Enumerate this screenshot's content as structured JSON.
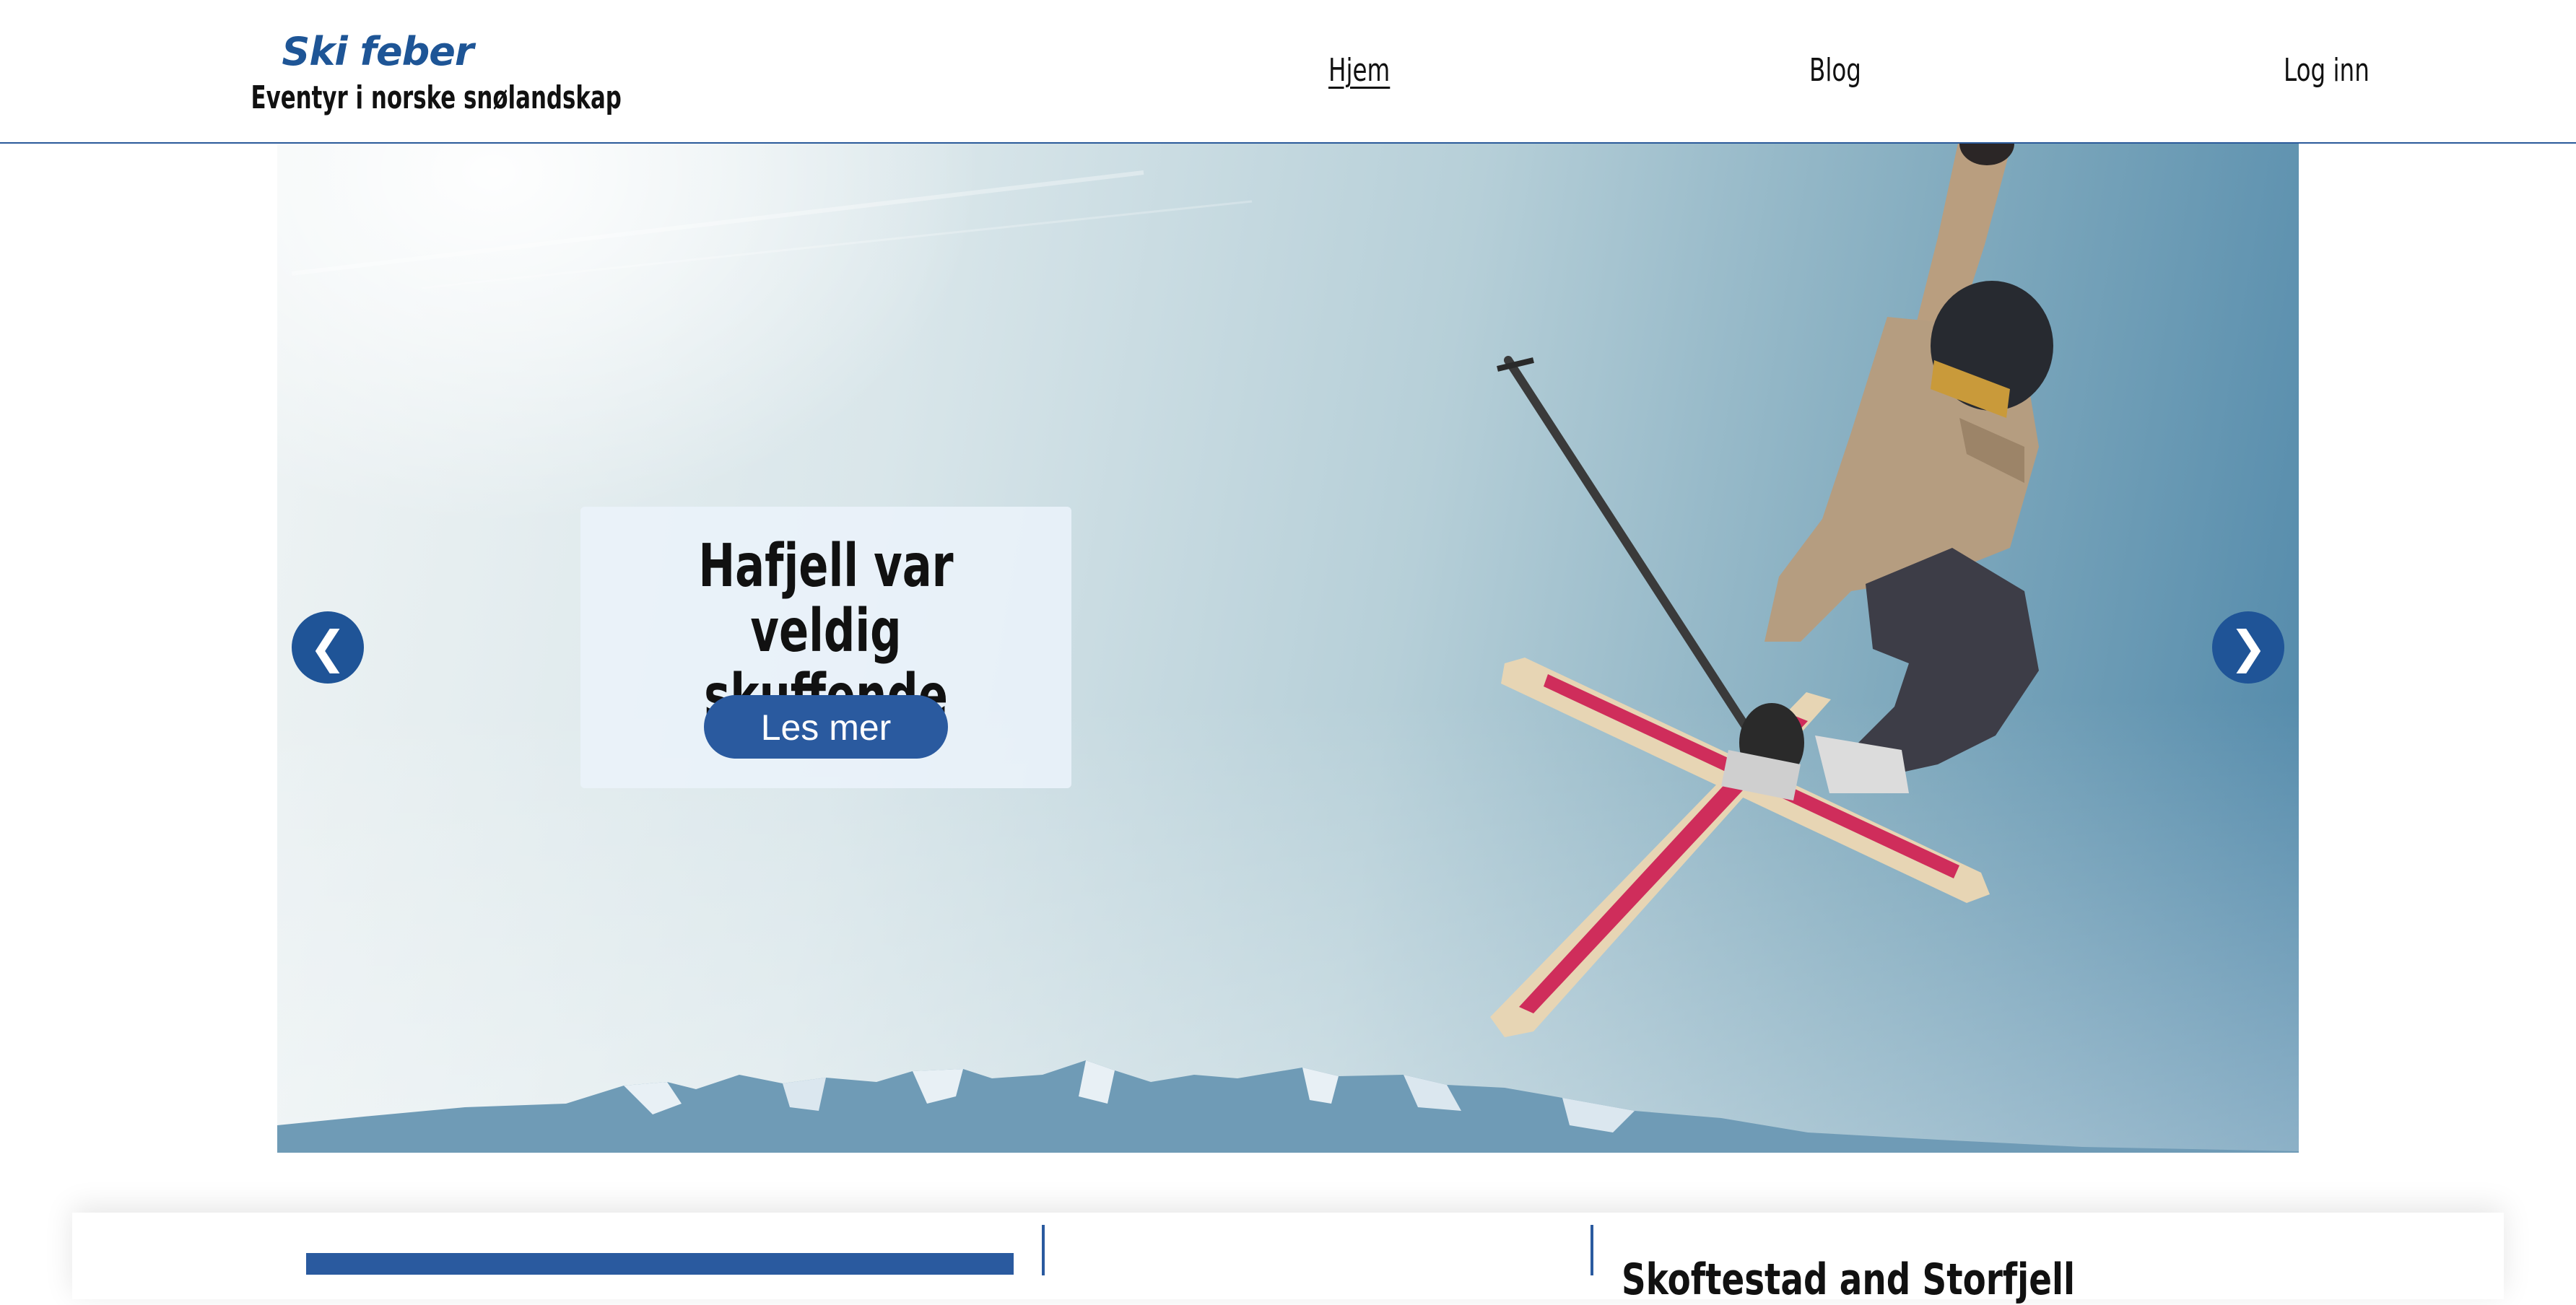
{
  "brand": {
    "title": "Ski feber",
    "tagline": "Eventyr i norske snølandskap",
    "color": "#1e5596"
  },
  "nav": {
    "items": [
      {
        "label": "Hjem",
        "active": true
      },
      {
        "label": "Blog",
        "active": false
      },
      {
        "label": "Log inn",
        "active": false
      }
    ]
  },
  "hero": {
    "slide_title": "Hafjell var veldig\nskuffende",
    "cta_label": "Les mer",
    "prev_icon": "❮",
    "next_icon": "❯",
    "accent_color": "#1f5497"
  },
  "cards": {
    "third_heading": "Skoftestad and Storfjell"
  }
}
